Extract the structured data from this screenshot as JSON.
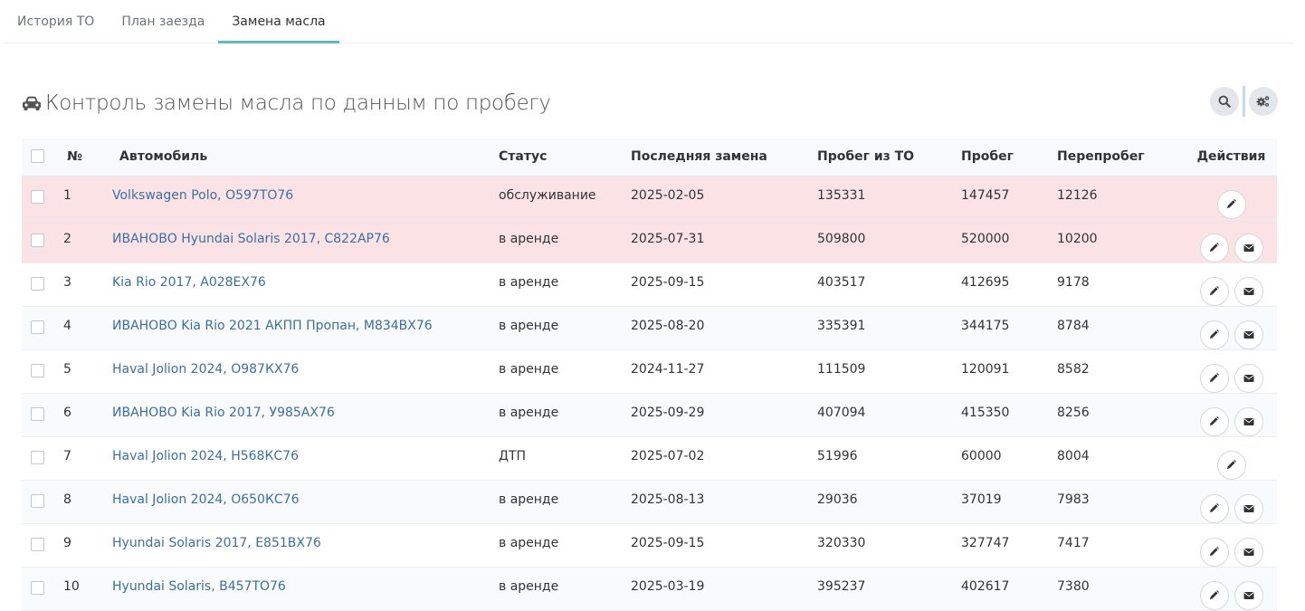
{
  "tabs": [
    {
      "label": "История ТО",
      "active": false
    },
    {
      "label": "План заезда",
      "active": false
    },
    {
      "label": "Замена масла",
      "active": true
    }
  ],
  "page": {
    "title": "Контроль замены масла по данным по пробегу",
    "title_icon": "car-icon",
    "tools": [
      "search-icon",
      "gears-icon"
    ]
  },
  "colors": {
    "accent": "#5bbcc6",
    "link": "#3a6fa5",
    "warn_row": "#fbe3e5"
  },
  "table": {
    "headers": {
      "num": "№",
      "car": "Автомобиль",
      "status": "Статус",
      "last": "Последняя замена",
      "to": "Пробег из ТО",
      "run": "Пробег",
      "over": "Перепробег",
      "actions": "Действия"
    },
    "rows": [
      {
        "num": "1",
        "car": "Volkswagen Polo, О597ТО76",
        "status": "обслуживание",
        "last": "2025-02-05",
        "to": "135331",
        "run": "147457",
        "over": "12126",
        "warn": true,
        "actions": [
          "edit"
        ]
      },
      {
        "num": "2",
        "car": "ИВАНОВО Hyundai Solaris 2017, С822АР76",
        "status": "в аренде",
        "last": "2025-07-31",
        "to": "509800",
        "run": "520000",
        "over": "10200",
        "warn": true,
        "actions": [
          "edit",
          "mail"
        ]
      },
      {
        "num": "3",
        "car": "Kia Rio 2017, А028ЕХ76",
        "status": "в аренде",
        "last": "2025-09-15",
        "to": "403517",
        "run": "412695",
        "over": "9178",
        "warn": false,
        "actions": [
          "edit",
          "mail"
        ]
      },
      {
        "num": "4",
        "car": "ИВАНОВО Kia Rio 2021 АКПП Пропан, М834ВХ76",
        "status": "в аренде",
        "last": "2025-08-20",
        "to": "335391",
        "run": "344175",
        "over": "8784",
        "warn": false,
        "actions": [
          "edit",
          "mail"
        ]
      },
      {
        "num": "5",
        "car": "Haval Jolion 2024, О987КХ76",
        "status": "в аренде",
        "last": "2024-11-27",
        "to": "111509",
        "run": "120091",
        "over": "8582",
        "warn": false,
        "actions": [
          "edit",
          "mail"
        ]
      },
      {
        "num": "6",
        "car": "ИВАНОВО Kia Rio 2017, У985АХ76",
        "status": "в аренде",
        "last": "2025-09-29",
        "to": "407094",
        "run": "415350",
        "over": "8256",
        "warn": false,
        "actions": [
          "edit",
          "mail"
        ]
      },
      {
        "num": "7",
        "car": "Haval Jolion 2024, Н568КС76",
        "status": "ДТП",
        "last": "2025-07-02",
        "to": "51996",
        "run": "60000",
        "over": "8004",
        "warn": false,
        "actions": [
          "edit"
        ]
      },
      {
        "num": "8",
        "car": "Haval Jolion 2024, О650КС76",
        "status": "в аренде",
        "last": "2025-08-13",
        "to": "29036",
        "run": "37019",
        "over": "7983",
        "warn": false,
        "actions": [
          "edit",
          "mail"
        ]
      },
      {
        "num": "9",
        "car": "Hyundai Solaris 2017, Е851ВХ76",
        "status": "в аренде",
        "last": "2025-09-15",
        "to": "320330",
        "run": "327747",
        "over": "7417",
        "warn": false,
        "actions": [
          "edit",
          "mail"
        ]
      },
      {
        "num": "10",
        "car": "Hyundai Solaris, В457ТО76",
        "status": "в аренде",
        "last": "2025-03-19",
        "to": "395237",
        "run": "402617",
        "over": "7380",
        "warn": false,
        "actions": [
          "edit",
          "mail"
        ]
      }
    ]
  }
}
